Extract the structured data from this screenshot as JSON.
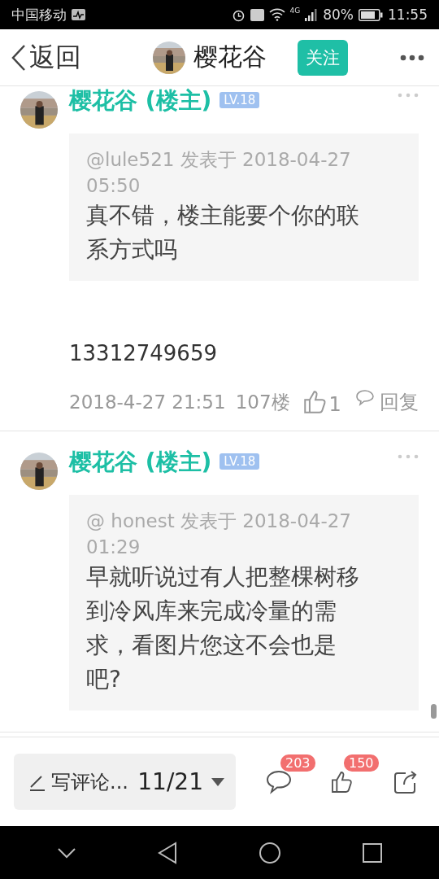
{
  "status_bar": {
    "carrier": "中国移动",
    "network": "4G",
    "battery": "80%",
    "time": "11:55"
  },
  "nav": {
    "back_label": "返回",
    "title": "樱花谷",
    "follow_button": "关注"
  },
  "posts": [
    {
      "author": "樱花谷 (楼主)",
      "level": "LV.18",
      "quote_author": "@lule521 发表于 2018-04-27 05:50",
      "quote_text": "真不错，楼主能要个你的联系方式吗",
      "reply_text": "13312749659",
      "meta": {
        "time": "2018-4-27 21:51",
        "floor": "107楼",
        "likes": "1",
        "reply": "回复"
      }
    },
    {
      "author": "樱花谷 (楼主)",
      "level": "LV.18",
      "quote_author": "@ honest 发表于 2018-04-27 01:29",
      "quote_text": "早就听说过有人把整棵树移到冷风库来完成冷量的需求，看图片您这不会也是吧?"
    }
  ],
  "bottom_bar": {
    "comment_placeholder": "写评论...",
    "page": "11/21",
    "comments_count": "203",
    "likes_count": "150"
  }
}
